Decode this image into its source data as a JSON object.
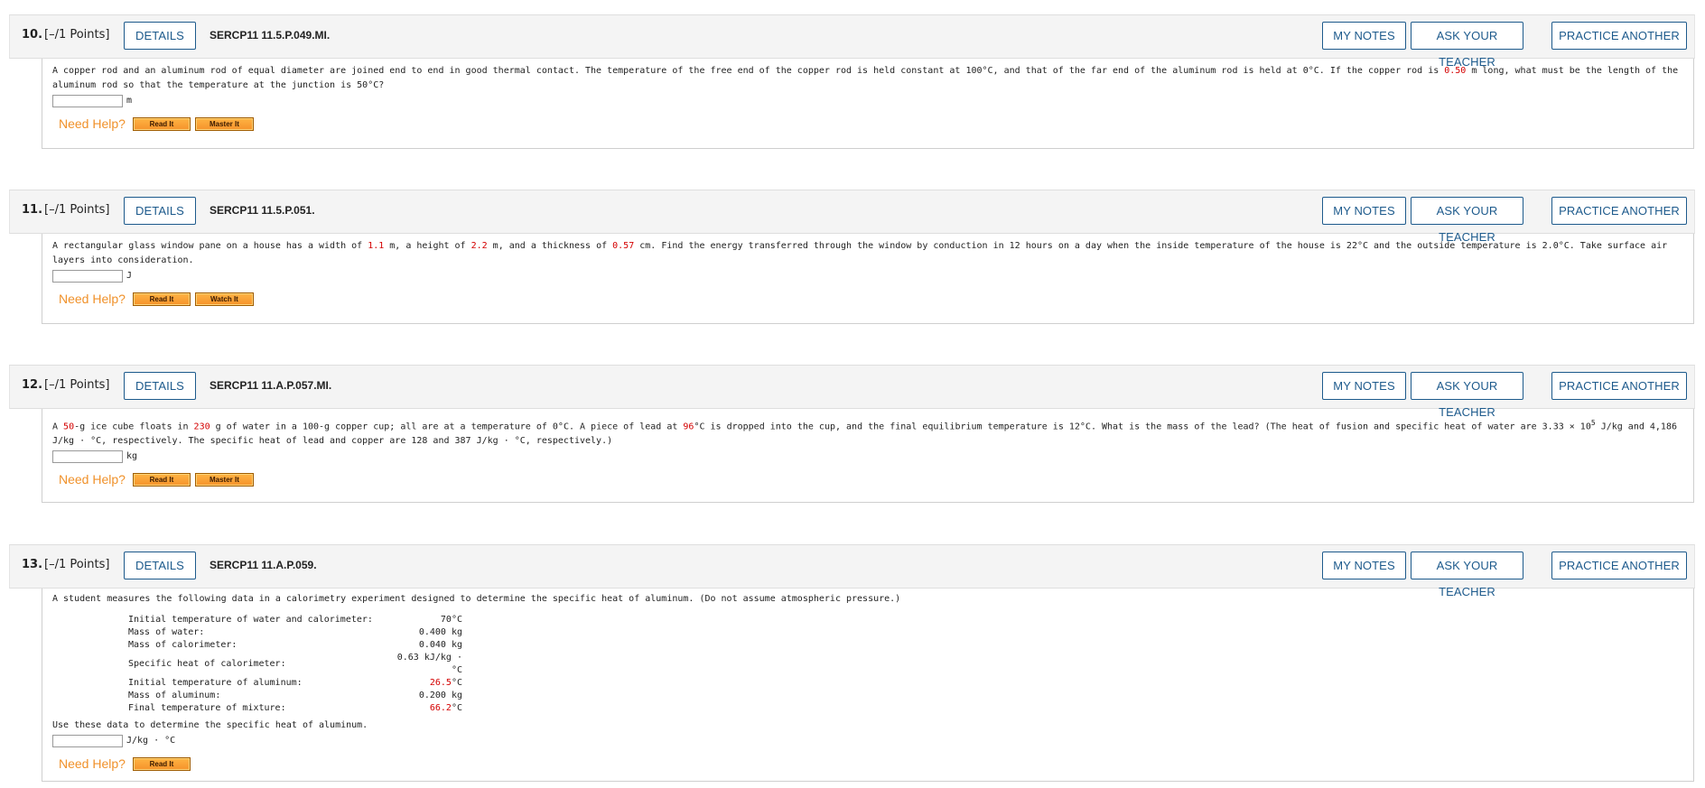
{
  "buttons": {
    "details": "DETAILS",
    "my_notes": "MY NOTES",
    "ask_teacher": "ASK YOUR TEACHER",
    "practice_another": "PRACTICE ANOTHER"
  },
  "help": {
    "need_help": "Need Help?",
    "read_it": "Read It",
    "master_it": "Master It",
    "watch_it": "Watch It"
  },
  "questions": [
    {
      "number": "10.",
      "points": "[–/1 Points]",
      "code": "SERCP11 11.5.P.049.MI.",
      "text_a": "A copper rod and an aluminum rod of equal diameter are joined end to end in good thermal contact. The temperature of the free end of the copper rod is held constant at 100°C, and that of the far end of the aluminum rod is held at 0°C. If the copper rod is ",
      "val1": "0.50",
      "text_b": " m long, what must be the length of the aluminum rod so that the temperature at the junction is 50°C?",
      "unit": "m"
    },
    {
      "number": "11.",
      "points": "[–/1 Points]",
      "code": "SERCP11 11.5.P.051.",
      "text_a": "A rectangular glass window pane on a house has a width of ",
      "val1": "1.1",
      "text_b": " m, a height of ",
      "val2": "2.2",
      "text_c": " m, and a thickness of ",
      "val3": "0.57",
      "text_d": " cm. Find the energy transferred through the window by conduction in 12 hours on a day when the inside temperature of the house is 22°C and the outside temperature is 2.0°C. Take surface air layers into consideration.",
      "unit": "J"
    },
    {
      "number": "12.",
      "points": "[–/1 Points]",
      "code": "SERCP11 11.A.P.057.MI.",
      "text_a": "A ",
      "val1": "50",
      "text_b": "-g ice cube floats in ",
      "val2": "230",
      "text_c": " g of water in a 100-g copper cup; all are at a temperature of 0°C. A piece of lead at ",
      "val3": "96",
      "text_d": "°C is dropped into the cup, and the final equilibrium temperature is 12°C. What is the mass of the lead? (The heat of fusion and specific heat of water are 3.33 × 10",
      "sup": "5",
      "text_e": " J/kg and 4,186 J/kg · °C, respectively. The specific heat of lead and copper are 128 and 387 J/kg · °C, respectively.)",
      "unit": "kg"
    },
    {
      "number": "13.",
      "points": "[–/1 Points]",
      "code": "SERCP11 11.A.P.059.",
      "text_a": "A student measures the following data in a calorimetry experiment designed to determine the specific heat of aluminum. (Do not assume atmospheric pressure.)",
      "rows": [
        {
          "label": "Initial temperature of water and calorimeter:",
          "value": "70°C"
        },
        {
          "label": "Mass of water:",
          "value": "0.400 kg"
        },
        {
          "label": "Mass of calorimeter:",
          "value": "0.040 kg"
        },
        {
          "label": "Specific heat of calorimeter:",
          "value": "0.63 kJ/kg · °C"
        },
        {
          "label": "Initial temperature of aluminum:",
          "value_red": "26.5",
          "value_rest": "°C"
        },
        {
          "label": "Mass of aluminum:",
          "value": "0.200 kg"
        },
        {
          "label": "Final temperature of mixture:",
          "value_red": "66.2",
          "value_rest": "°C"
        }
      ],
      "text_after": "Use these data to determine the specific heat of aluminum.",
      "unit": "J/kg · °C"
    }
  ]
}
